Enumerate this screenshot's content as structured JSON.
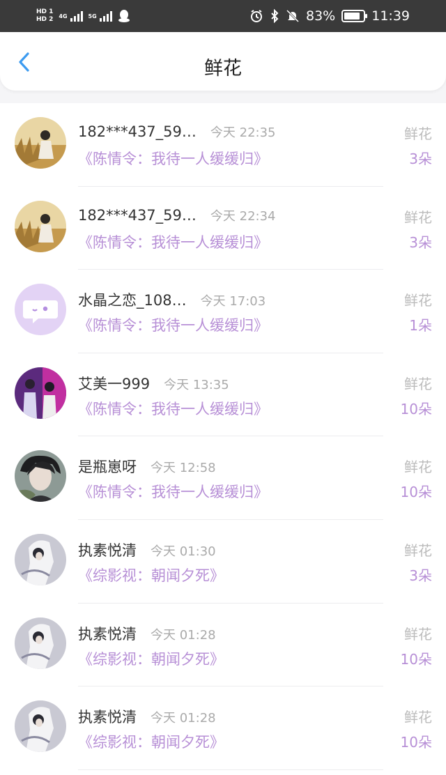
{
  "status_bar": {
    "hd1": "HD 1",
    "hd2": "HD 2",
    "net1": "4G",
    "net2": "5G",
    "battery_percent": "83%",
    "battery_level": 0.83,
    "clock": "11:39"
  },
  "header": {
    "title": "鲜花"
  },
  "items": [
    {
      "user": "182***437_59…",
      "time": "今天 22:35",
      "book": "《陈情令：我待一人缓缓归》",
      "type": "鲜花",
      "count": "3朵",
      "avatar": "avatar-landscape-icon"
    },
    {
      "user": "182***437_59…",
      "time": "今天 22:34",
      "book": "《陈情令：我待一人缓缓归》",
      "type": "鲜花",
      "count": "3朵",
      "avatar": "avatar-landscape-icon"
    },
    {
      "user": "水晶之恋_108…",
      "time": "今天 17:03",
      "book": "《陈情令：我待一人缓缓归》",
      "type": "鲜花",
      "count": "1朵",
      "avatar": "chat-bubble-icon"
    },
    {
      "user": "艾美一999",
      "time": "今天 13:35",
      "book": "《陈情令：我待一人缓缓归》",
      "type": "鲜花",
      "count": "10朵",
      "avatar": "avatar-stage-icon"
    },
    {
      "user": "是瓶崽呀",
      "time": "今天 12:58",
      "book": "《陈情令：我待一人缓缓归》",
      "type": "鲜花",
      "count": "10朵",
      "avatar": "avatar-portrait-icon"
    },
    {
      "user": "执素悦清",
      "time": "今天 01:30",
      "book": "《综影视：朝闻夕死》",
      "type": "鲜花",
      "count": "3朵",
      "avatar": "avatar-figure-icon"
    },
    {
      "user": "执素悦清",
      "time": "今天 01:28",
      "book": "《综影视：朝闻夕死》",
      "type": "鲜花",
      "count": "10朵",
      "avatar": "avatar-figure-icon"
    },
    {
      "user": "执素悦清",
      "time": "今天 01:28",
      "book": "《综影视：朝闻夕死》",
      "type": "鲜花",
      "count": "10朵",
      "avatar": "avatar-figure-icon"
    }
  ],
  "colors": {
    "accent_purple": "#b78fd6",
    "back_blue": "#3d9bf0",
    "status_bar_bg": "#3a3a3a"
  }
}
